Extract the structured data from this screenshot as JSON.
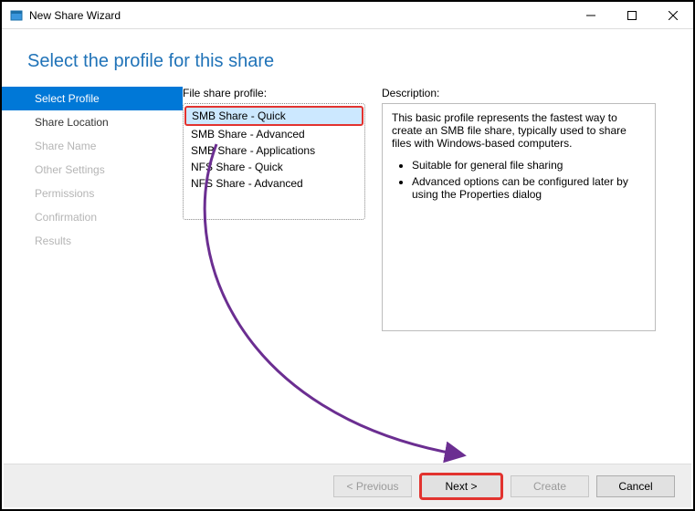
{
  "window": {
    "title": "New Share Wizard"
  },
  "heading": "Select the profile for this share",
  "nav": {
    "items": [
      {
        "label": "Select Profile",
        "state": "active"
      },
      {
        "label": "Share Location",
        "state": "enabled"
      },
      {
        "label": "Share Name",
        "state": "disabled"
      },
      {
        "label": "Other Settings",
        "state": "disabled"
      },
      {
        "label": "Permissions",
        "state": "disabled"
      },
      {
        "label": "Confirmation",
        "state": "disabled"
      },
      {
        "label": "Results",
        "state": "disabled"
      }
    ]
  },
  "profiles": {
    "label": "File share profile:",
    "items": [
      "SMB Share - Quick",
      "SMB Share - Advanced",
      "SMB Share - Applications",
      "NFS Share - Quick",
      "NFS Share - Advanced"
    ],
    "selected_index": 0
  },
  "description": {
    "label": "Description:",
    "text": "This basic profile represents the fastest way to create an SMB file share, typically used to share files with Windows-based computers.",
    "bullets": [
      "Suitable for general file sharing",
      "Advanced options can be configured later by using the Properties dialog"
    ]
  },
  "footer": {
    "previous": "< Previous",
    "next": "Next >",
    "create": "Create",
    "cancel": "Cancel"
  }
}
